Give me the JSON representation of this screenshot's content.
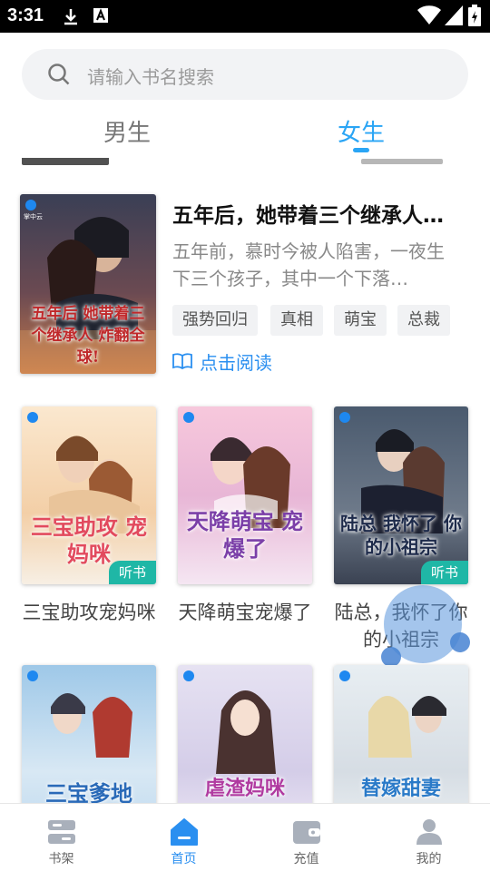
{
  "status_bar": {
    "time": "3:31"
  },
  "search": {
    "placeholder": "请输入书名搜索"
  },
  "tabs": [
    {
      "label": "男生",
      "active": false
    },
    {
      "label": "女生",
      "active": true
    }
  ],
  "featured": {
    "title": "五年后，她带着三个继承人…",
    "description": "五年前，慕时今被人陷害，一夜生下三个孩子，其中一个下落…",
    "tags": [
      "强势回归",
      "真相",
      "萌宝",
      "总裁"
    ],
    "read_label": "点击阅读",
    "cover_text": "五年后 她带着三个继承人 炸翻全球!"
  },
  "grid": [
    {
      "title": "三宝助攻宠妈咪",
      "cover_text": "三宝助攻 宠妈咪",
      "audio_badge": "听书"
    },
    {
      "title": "天降萌宝宠爆了",
      "cover_text": "天降萌宝 宠爆了",
      "audio_badge": ""
    },
    {
      "title": "陆总，我怀了你的小祖宗",
      "cover_text": "陆总 我怀了 你的小祖宗",
      "audio_badge": "听书"
    },
    {
      "title": "",
      "cover_text": "三宝爹地",
      "audio_badge": ""
    },
    {
      "title": "",
      "cover_text": "虐渣妈咪",
      "audio_badge": ""
    },
    {
      "title": "",
      "cover_text": "替嫁甜妻",
      "audio_badge": ""
    }
  ],
  "brand_mark": "掌中云",
  "bottom_nav": [
    {
      "label": "书架",
      "icon": "bookshelf-icon",
      "active": false
    },
    {
      "label": "首页",
      "icon": "home-icon",
      "active": true
    },
    {
      "label": "充值",
      "icon": "wallet-icon",
      "active": false
    },
    {
      "label": "我的",
      "icon": "profile-icon",
      "active": false
    }
  ],
  "colors": {
    "accent": "#2aa5f5",
    "link": "#2a8ff0",
    "badge": "#1fb7a6"
  }
}
